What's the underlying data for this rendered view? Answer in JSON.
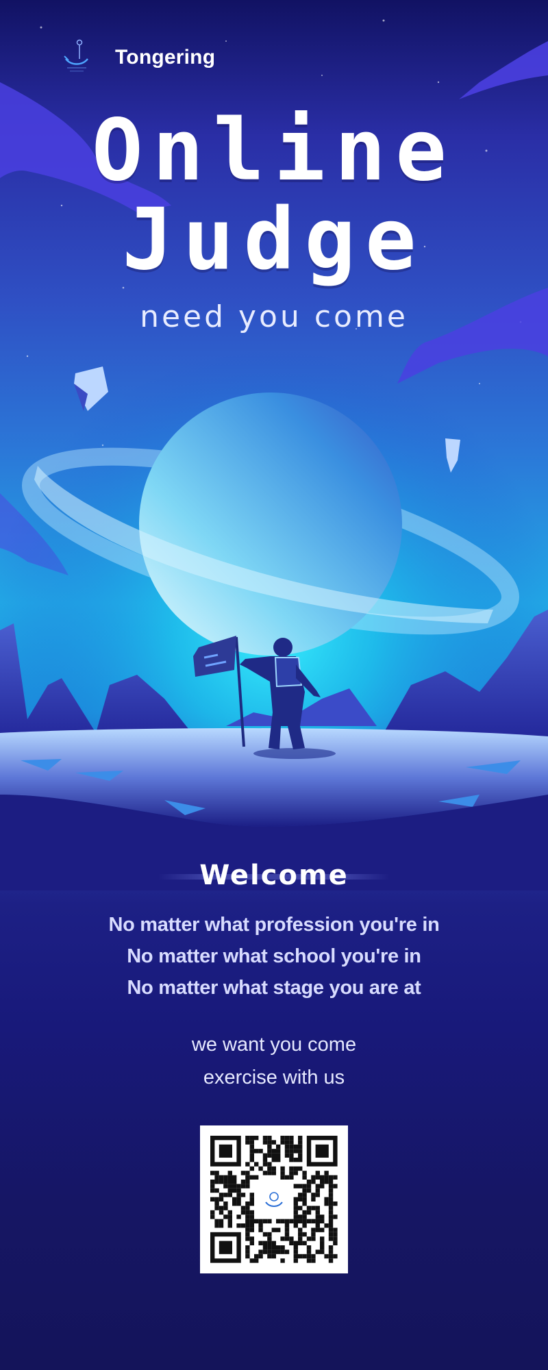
{
  "brand": {
    "name": "Tongering",
    "logo_icon": "anchor-logo-icon"
  },
  "hero": {
    "title_line1": "Online",
    "title_line2": "Judge",
    "subtitle": "need you come"
  },
  "welcome": {
    "title": "Welcome",
    "lines": [
      "No matter what profession you're in",
      "No matter what school you're in",
      "No matter what stage you are at"
    ],
    "invite": [
      "we want you come",
      "exercise with us"
    ]
  },
  "qr": {
    "icon": "qr-code-icon"
  },
  "colors": {
    "deep_navy": "#161a6b",
    "planet_cyan": "#22e0f0",
    "indigo": "#2a2ea6",
    "text_light": "#d8dcff"
  }
}
